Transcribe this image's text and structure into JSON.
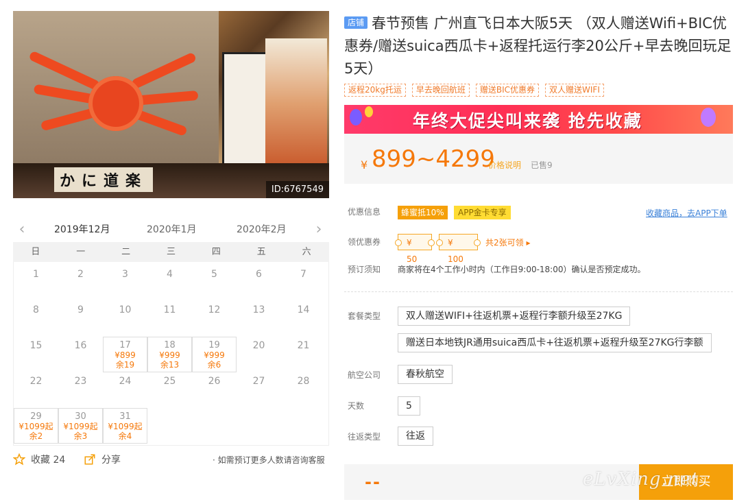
{
  "photo": {
    "id_label": "ID:6767549",
    "kana_text": "かに道楽"
  },
  "calendar": {
    "months": [
      "2019年12月",
      "2020年1月",
      "2020年2月"
    ],
    "weekdays": [
      "日",
      "一",
      "二",
      "三",
      "四",
      "五",
      "六"
    ],
    "days": [
      {
        "d": "1"
      },
      {
        "d": "2"
      },
      {
        "d": "3"
      },
      {
        "d": "4"
      },
      {
        "d": "5"
      },
      {
        "d": "6"
      },
      {
        "d": "7"
      },
      {
        "d": "8"
      },
      {
        "d": "9"
      },
      {
        "d": "10"
      },
      {
        "d": "11"
      },
      {
        "d": "12"
      },
      {
        "d": "13"
      },
      {
        "d": "14"
      },
      {
        "d": "15"
      },
      {
        "d": "16"
      },
      {
        "d": "17",
        "price": "¥899",
        "left": "余19"
      },
      {
        "d": "18",
        "price": "¥999",
        "left": "余13"
      },
      {
        "d": "19",
        "price": "¥999",
        "left": "余6"
      },
      {
        "d": "20"
      },
      {
        "d": "21"
      },
      {
        "d": "22"
      },
      {
        "d": "23"
      },
      {
        "d": "24"
      },
      {
        "d": "25"
      },
      {
        "d": "26"
      },
      {
        "d": "27"
      },
      {
        "d": "28"
      },
      {
        "d": "29",
        "price": "¥1099起",
        "left": "余2"
      },
      {
        "d": "30",
        "price": "¥1099起",
        "left": "余3"
      },
      {
        "d": "31",
        "price": "¥1099起",
        "left": "余4"
      }
    ]
  },
  "actions": {
    "fav_label": "收藏 24",
    "share_label": "分享",
    "note": "· 如需预订更多人数请咨询客服"
  },
  "product": {
    "badge": "店铺",
    "title": "春节预售 广州直飞日本大阪5天 （双人赠送Wifi+BIC优惠券/赠送suica西瓜卡+返程托运行李20公斤+早去晚回玩足5天）",
    "tags": [
      "返程20kg托运",
      "早去晚回航班",
      "赠送BIC优惠券",
      "双人赠送WIFI"
    ],
    "banner_text": "年终大促尖叫来袭 抢先收藏"
  },
  "price": {
    "currency": "¥",
    "range": "899~4299",
    "explain_label": "价格说明",
    "sold": "已售9"
  },
  "promo": {
    "label": "优惠信息",
    "tag1": "蜂蜜抵10%",
    "tag2": "APP金卡专享",
    "fav_link": "收藏商品，去APP下单"
  },
  "coupon": {
    "label": "领优惠券",
    "c1": "¥ 50",
    "c2": "¥ 100",
    "more": "共2张可领 ▸"
  },
  "booking": {
    "label": "预订须知",
    "text": "商家将在4个工作小时内（工作日9:00-18:00）确认是否预定成功。"
  },
  "options": {
    "package_label": "套餐类型",
    "packages": [
      "双人赠送WIFI+往返机票+返程行李额升级至27KG",
      "赠送日本地铁JR通用suica西瓜卡+往返机票+返程升级至27KG行李额"
    ],
    "airline_label": "航空公司",
    "airline": "春秋航空",
    "days_label": "天数",
    "days": "5",
    "trip_label": "往返类型",
    "trip": "往返"
  },
  "buy": {
    "price_placeholder": "--",
    "button": "立即购买",
    "watermark": "eLvXing.net"
  },
  "colors": {
    "accent": "#f5780a",
    "buy": "#f5a00a",
    "badge": "#5b9bf3",
    "link": "#3a80d8"
  }
}
